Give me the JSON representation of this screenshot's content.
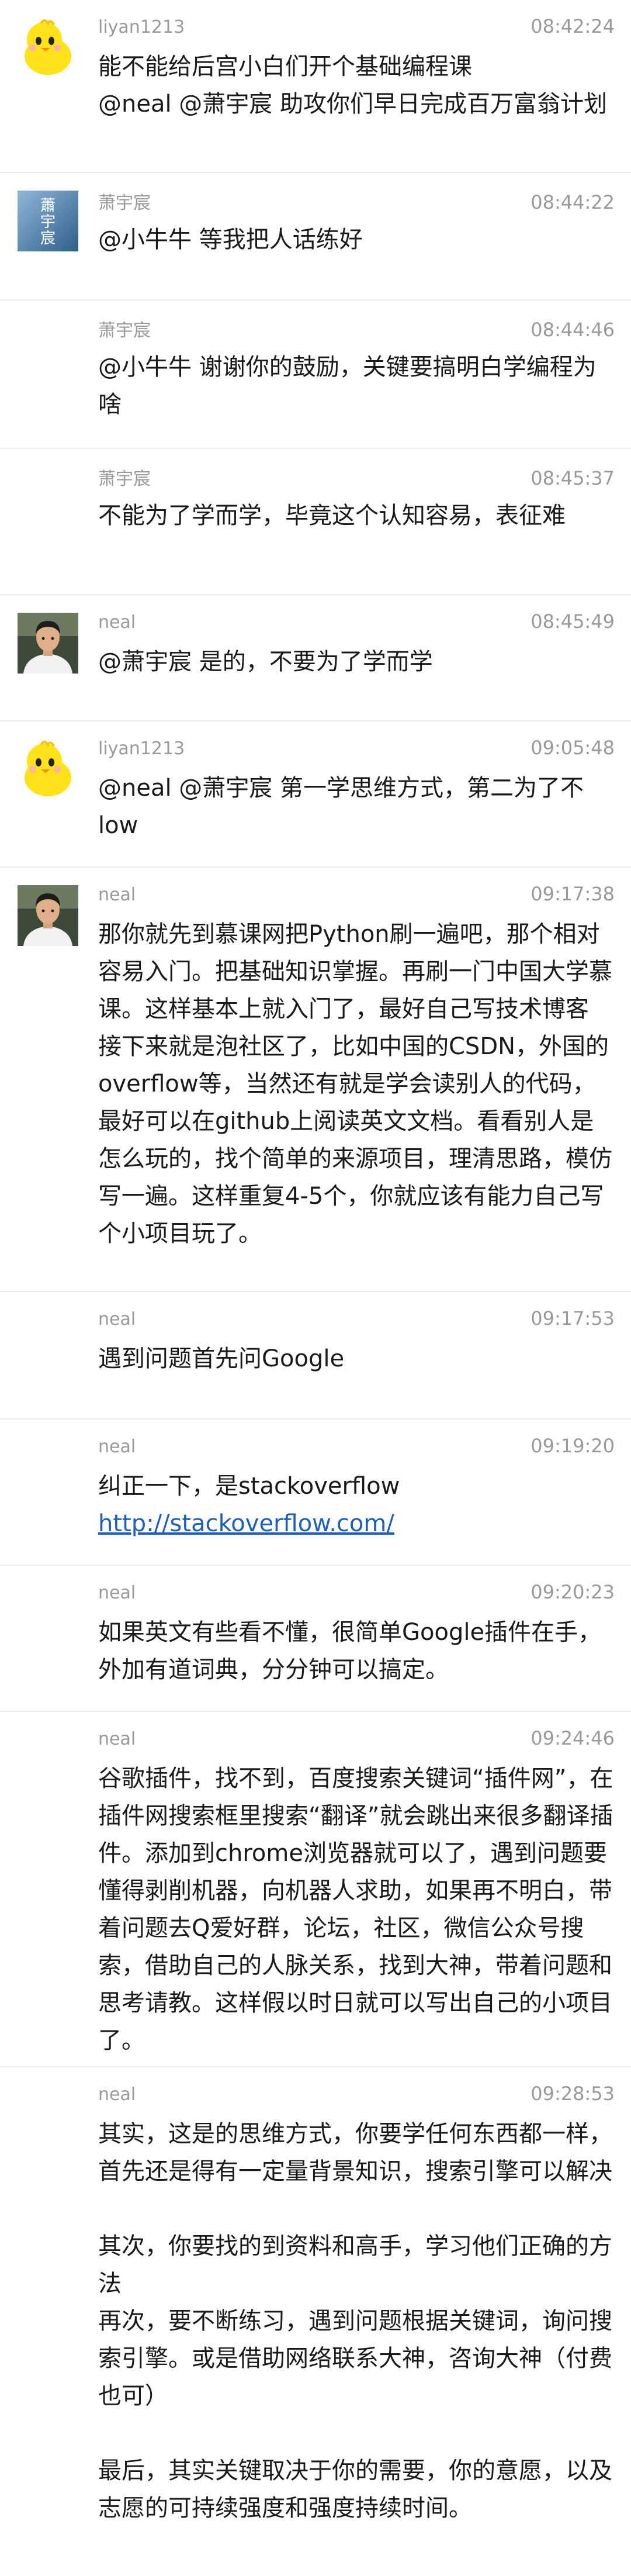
{
  "messages": [
    {
      "sender": "liyan1213",
      "time": "08:42:24",
      "avatar": "yellow-chick-icon",
      "text": "能不能给后宫小白们开个基础编程课\n@neal @萧宇宸 助攻你们早日完成百万富翁计划"
    },
    {
      "sender": "萧宇宸",
      "time": "08:44:22",
      "avatar": "calligraphy-icon",
      "avatar_glyph": "蕭宇宸",
      "text": "@小牛牛 等我把人话练好"
    },
    {
      "sender": "萧宇宸",
      "time": "08:44:46",
      "avatar": "",
      "text": "@小牛牛 谢谢你的鼓励，关键要搞明白学编程为啥"
    },
    {
      "sender": "萧宇宸",
      "time": "08:45:37",
      "avatar": "",
      "text": "不能为了学而学，毕竟这个认知容易，表征难"
    },
    {
      "sender": "neal",
      "time": "08:45:49",
      "avatar": "person-photo-icon",
      "text": "@萧宇宸 是的，不要为了学而学"
    },
    {
      "sender": "liyan1213",
      "time": "09:05:48",
      "avatar": "yellow-chick-icon",
      "text": "@neal @萧宇宸 第一学思维方式，第二为了不low"
    },
    {
      "sender": "neal",
      "time": "09:17:38",
      "avatar": "person-photo-icon",
      "text": "那你就先到慕课网把Python刷一遍吧，那个相对容易入门。把基础知识掌握。再刷一门中国大学慕课。这样基本上就入门了，最好自己写技术博客\n接下来就是泡社区了，比如中国的CSDN，外国的overflow等，当然还有就是学会读别人的代码，最好可以在github上阅读英文文档。看看别人是怎么玩的，找个简单的来源项目，理清思路，模仿写一遍。这样重复4-5个，你就应该有能力自己写个小项目玩了。"
    },
    {
      "sender": "neal",
      "time": "09:17:53",
      "avatar": "",
      "text": "遇到问题首先问Google"
    },
    {
      "sender": "neal",
      "time": "09:19:20",
      "avatar": "",
      "text": "纠正一下，是stackoverflow",
      "link": "http://stackoverflow.com/"
    },
    {
      "sender": "neal",
      "time": "09:20:23",
      "avatar": "",
      "text": "如果英文有些看不懂，很简单Google插件在手，外加有道词典，分分钟可以搞定。"
    },
    {
      "sender": "neal",
      "time": "09:24:46",
      "avatar": "",
      "text": "谷歌插件，找不到，百度搜索关键词“插件网”，在插件网搜索框里搜索“翻译”就会跳出来很多翻译插件。添加到chrome浏览器就可以了，遇到问题要懂得剥削机器，向机器人求助，如果再不明白，带着问题去Q爱好群，论坛，社区，微信公众号搜索，借助自己的人脉关系，找到大神，带着问题和思考请教。这样假以时日就可以写出自己的小项目了。"
    },
    {
      "sender": "neal",
      "time": "09:28:53",
      "avatar": "",
      "text": "其实，这是的思维方式，你要学任何东西都一样，\n首先还是得有一定量背景知识，搜索引擎可以解决\n\n其次，你要找的到资料和高手，学习他们正确的方法\n再次，要不断练习，遇到问题根据关键词，询问搜索引擎。或是借助网络联系大神，咨询大神（付费也可）\n\n最后，其实关键取决于你的需要，你的意愿，以及志愿的可持续强度和强度持续时间。"
    }
  ]
}
